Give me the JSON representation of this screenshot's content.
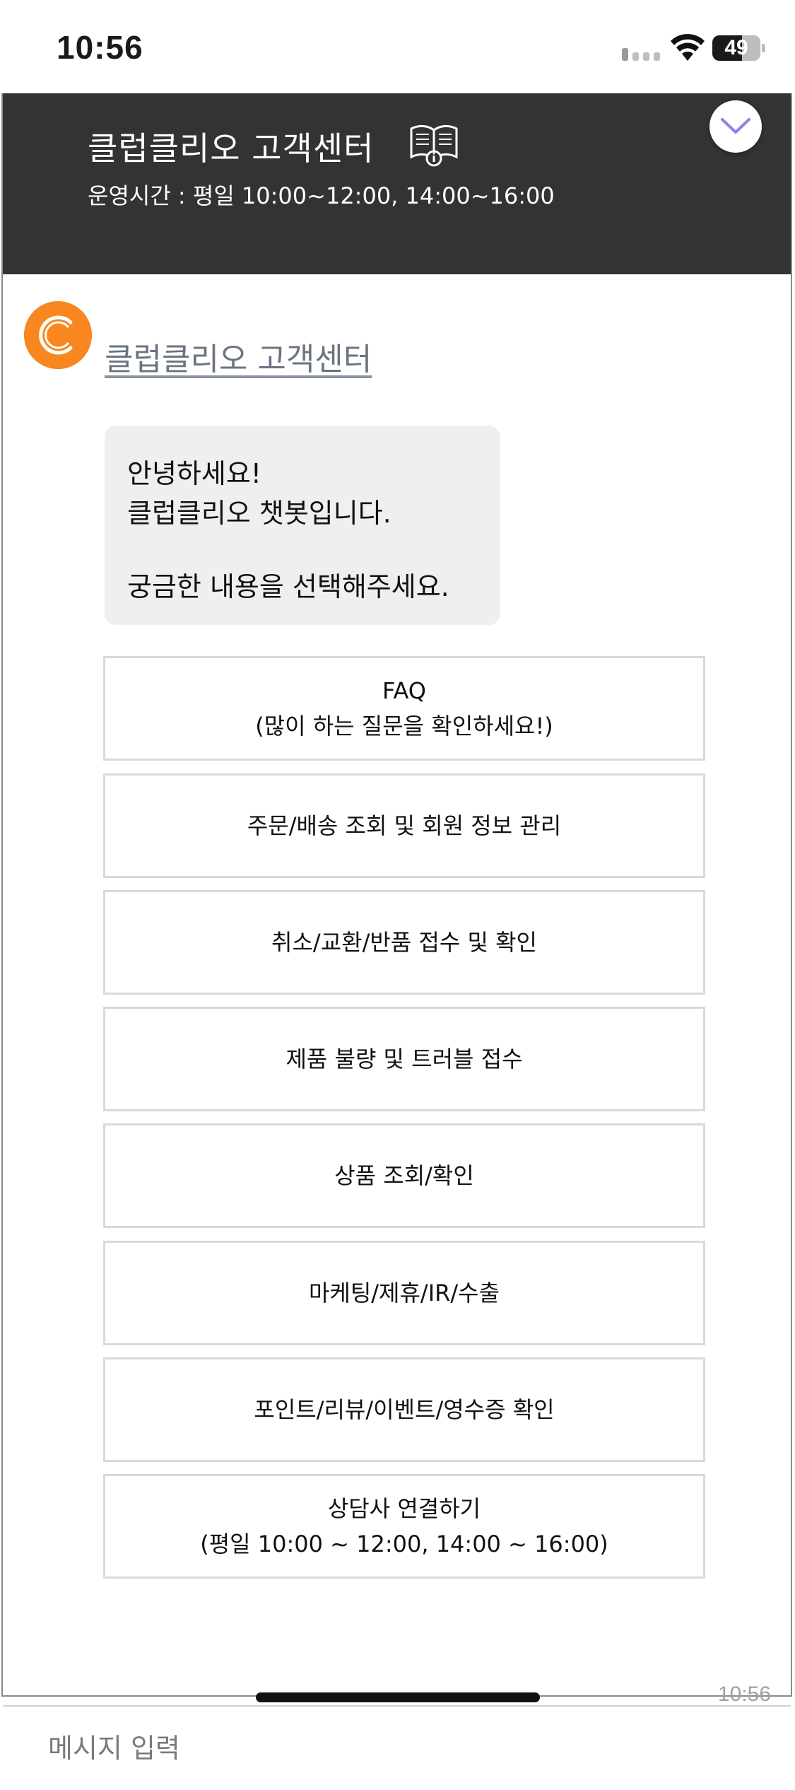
{
  "status_bar": {
    "time": "10:56",
    "battery": "49"
  },
  "header": {
    "title": "클럽클리오 고객센터",
    "hours": "운영시간 : 평일 10:00~12:00, 14:00~16:00",
    "book_icon": "book-info-icon",
    "collapse_icon": "chevron-down-icon"
  },
  "bot": {
    "name": "클럽클리오 고객센터",
    "avatar_icon": "clio-logo-icon"
  },
  "greeting": {
    "line1": "안녕하세요!",
    "line2": "클럽클리오 챗봇입니다.",
    "line3": "궁금한 내용을 선택해주세요."
  },
  "menu": [
    {
      "line1": "FAQ",
      "line2": "(많이 하는 질문을 확인하세요!)"
    },
    {
      "line1": "주문/배송 조회 및 회원 정보 관리",
      "line2": ""
    },
    {
      "line1": "취소/교환/반품 접수 및 확인",
      "line2": ""
    },
    {
      "line1": "제품 불량 및 트러블 접수",
      "line2": ""
    },
    {
      "line1": "상품 조회/확인",
      "line2": ""
    },
    {
      "line1": "마케팅/제휴/IR/수출",
      "line2": ""
    },
    {
      "line1": "포인트/리뷰/이벤트/영수증 확인",
      "line2": ""
    },
    {
      "line1": "상담사 연결하기",
      "line2": "(평일 10:00 ~ 12:00, 14:00 ~ 16:00)"
    }
  ],
  "message_time": "10:56",
  "input": {
    "placeholder": "메시지 입력",
    "value": ""
  },
  "colors": {
    "header_bg": "#333333",
    "brand_orange": "#f7871e",
    "collapse_accent": "#9b7be6",
    "bubble_bg": "#eef0f0",
    "button_border": "#d9d9d9"
  }
}
